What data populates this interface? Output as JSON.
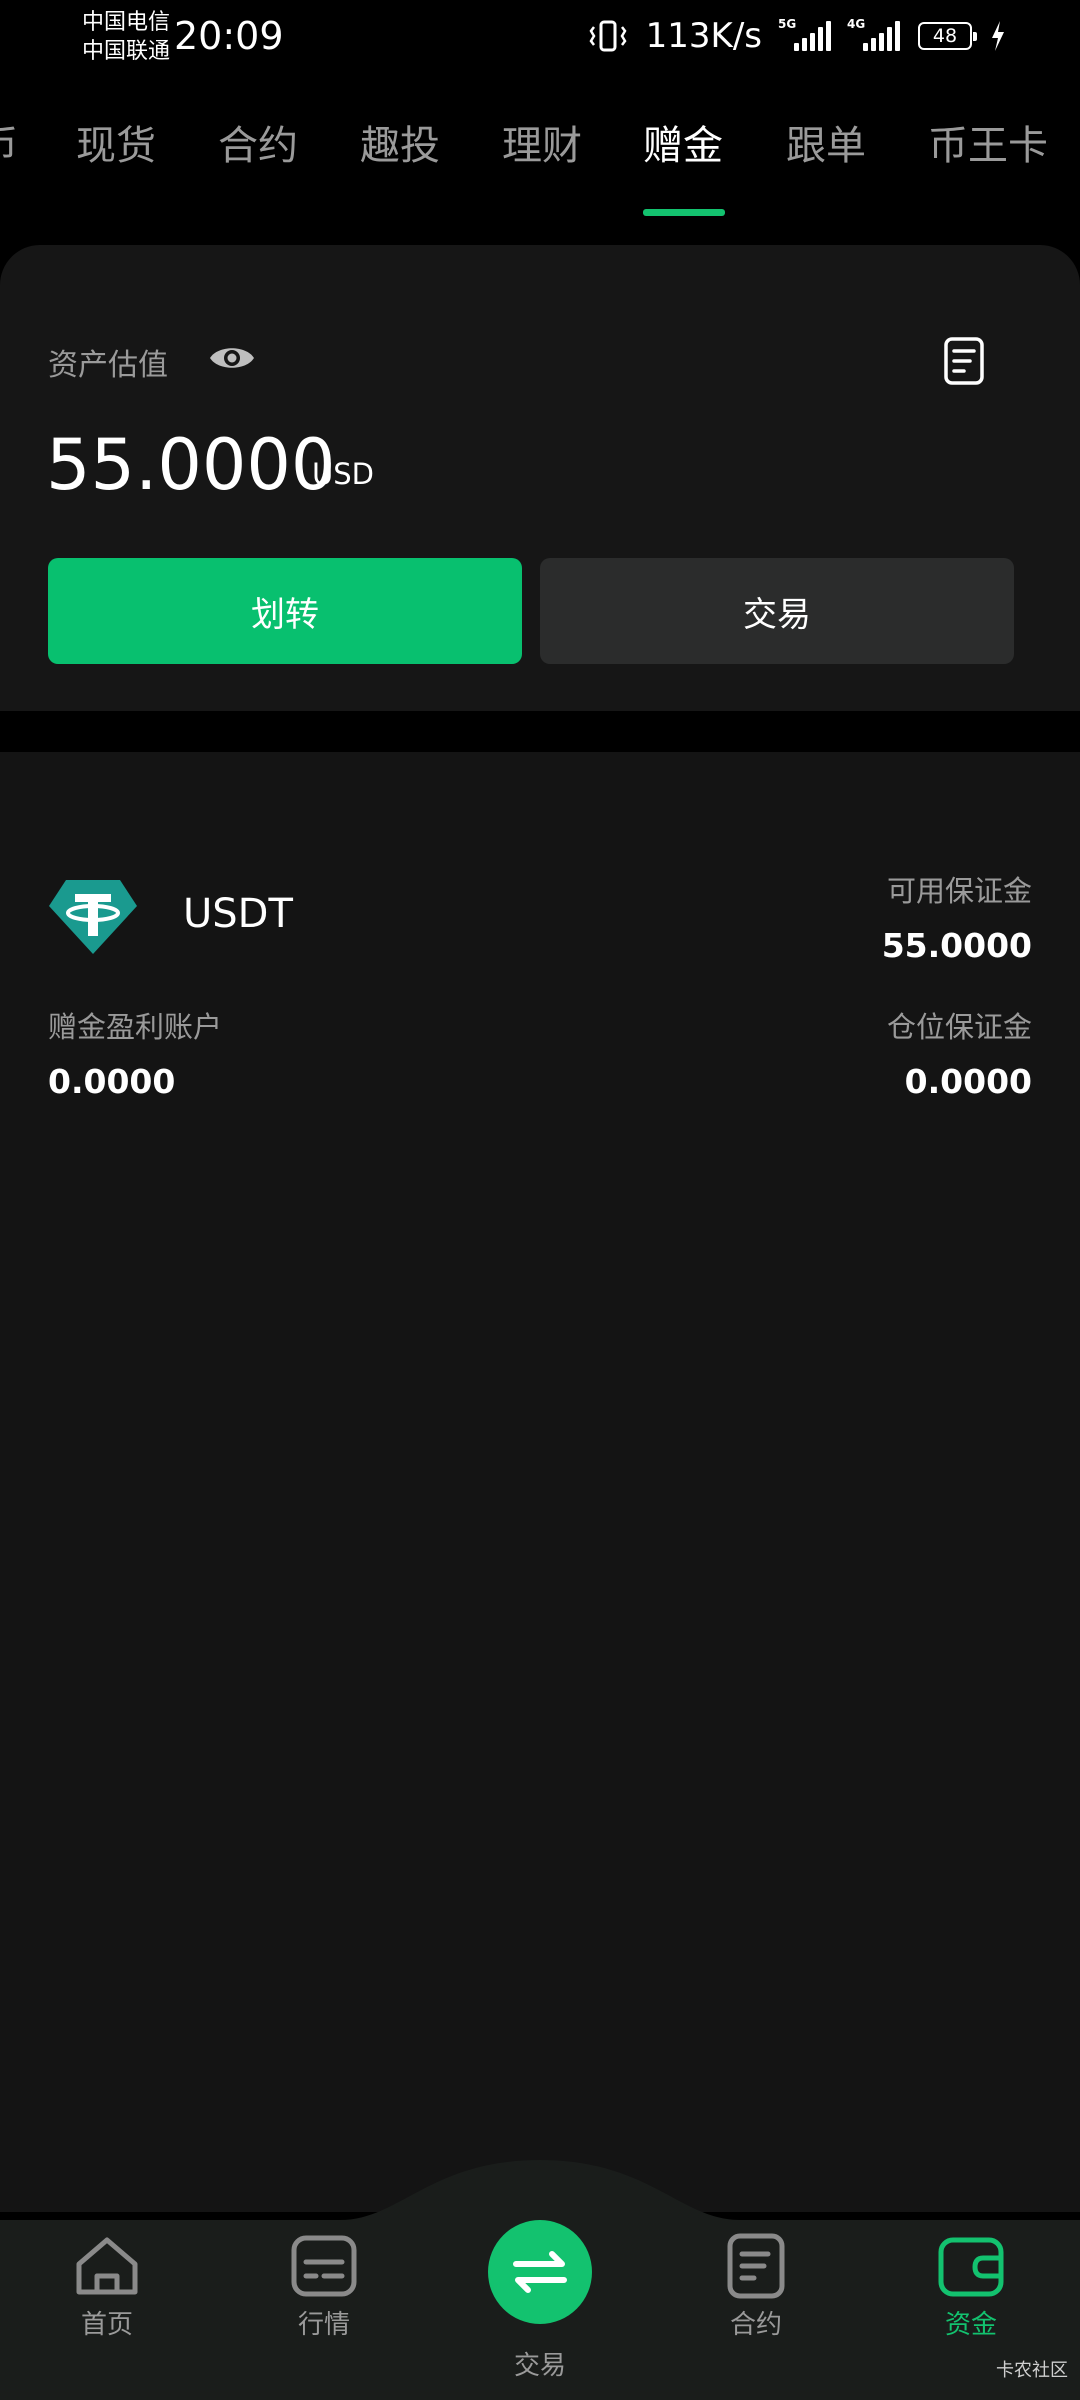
{
  "status_bar": {
    "carrier_1": "中国电信",
    "carrier_2": "中国联通",
    "time": "20:09",
    "net_speed": "113K/s",
    "signal_1_label": "5G",
    "signal_2_label": "4G",
    "battery": "48"
  },
  "tabs": [
    {
      "label": "币"
    },
    {
      "label": "现货"
    },
    {
      "label": "合约"
    },
    {
      "label": "趣投"
    },
    {
      "label": "理财"
    },
    {
      "label": "赠金"
    },
    {
      "label": "跟单"
    },
    {
      "label": "币王卡"
    }
  ],
  "active_tab": "赠金",
  "asset": {
    "label": "资产估值",
    "value": "55.0000",
    "unit": "USD",
    "transfer_label": "划转",
    "trade_label": "交易"
  },
  "coin": {
    "name": "USDT",
    "available_margin_label": "可用保证金",
    "available_margin_value": "55.0000",
    "bonus_profit_label": "赠金盈利账户",
    "bonus_profit_value": "0.0000",
    "position_margin_label": "仓位保证金",
    "position_margin_value": "0.0000"
  },
  "nav": {
    "home": "首页",
    "market": "行情",
    "trade": "交易",
    "contract": "合约",
    "assets": "资金"
  },
  "watermark": "卡农社区",
  "colors": {
    "accent": "#13c26f",
    "background": "#141414",
    "card": "#161616",
    "usdt": "#26a17b"
  }
}
